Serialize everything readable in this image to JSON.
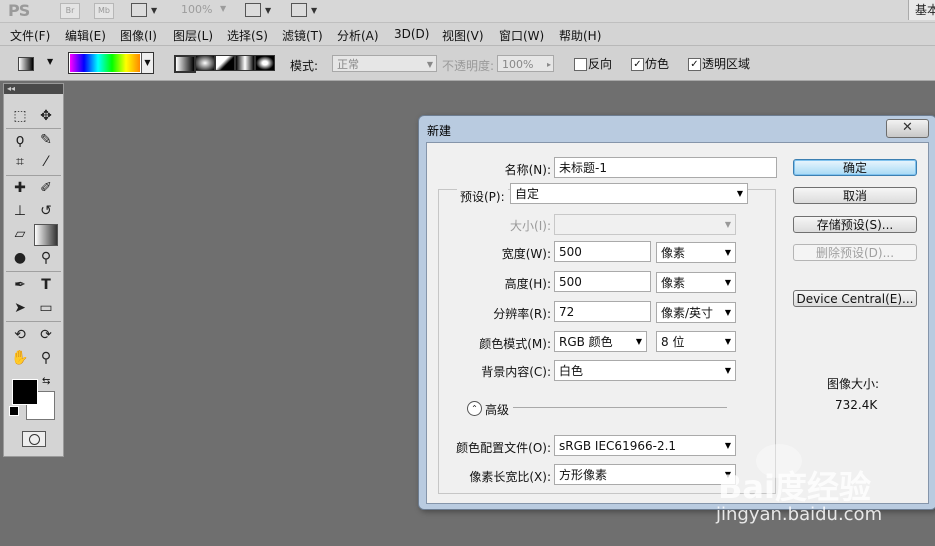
{
  "app": {
    "logo": "PS",
    "zoom": "100%",
    "workspace": "基本"
  },
  "menu": [
    "文件(F)",
    "编辑(E)",
    "图像(I)",
    "图层(L)",
    "选择(S)",
    "滤镜(T)",
    "分析(A)",
    "3D(D)",
    "视图(V)",
    "窗口(W)",
    "帮助(H)"
  ],
  "options": {
    "mode_label": "模式:",
    "mode_value": "正常",
    "opacity_label": "不透明度:",
    "opacity_value": "100%",
    "reverse": "反向",
    "dither": "仿色",
    "transparency": "透明区域",
    "reverse_checked": false,
    "dither_checked": true,
    "transparency_checked": true
  },
  "dialog": {
    "title": "新建",
    "close": "✕",
    "name_label": "名称(N):",
    "name_value": "未标题-1",
    "preset_label": "预设(P):",
    "preset_value": "自定",
    "size_label": "大小(I):",
    "width_label": "宽度(W):",
    "width_value": "500",
    "width_unit": "像素",
    "height_label": "高度(H):",
    "height_value": "500",
    "height_unit": "像素",
    "resolution_label": "分辨率(R):",
    "resolution_value": "72",
    "resolution_unit": "像素/英寸",
    "color_mode_label": "颜色模式(M):",
    "color_mode_value": "RGB 颜色",
    "bit_depth": "8 位",
    "bg_label": "背景内容(C):",
    "bg_value": "白色",
    "advanced": "高级",
    "profile_label": "颜色配置文件(O):",
    "profile_value": "sRGB IEC61966-2.1",
    "aspect_label": "像素长宽比(X):",
    "aspect_value": "方形像素",
    "buttons": {
      "ok": "确定",
      "cancel": "取消",
      "save_preset": "存储预设(S)...",
      "delete_preset": "删除预设(D)...",
      "device_central": "Device Central(E)..."
    },
    "image_size_label": "图像大小:",
    "image_size_value": "732.4K"
  },
  "watermark": {
    "logo": "Bai度经验",
    "url": "jingyan.baidu.com"
  }
}
